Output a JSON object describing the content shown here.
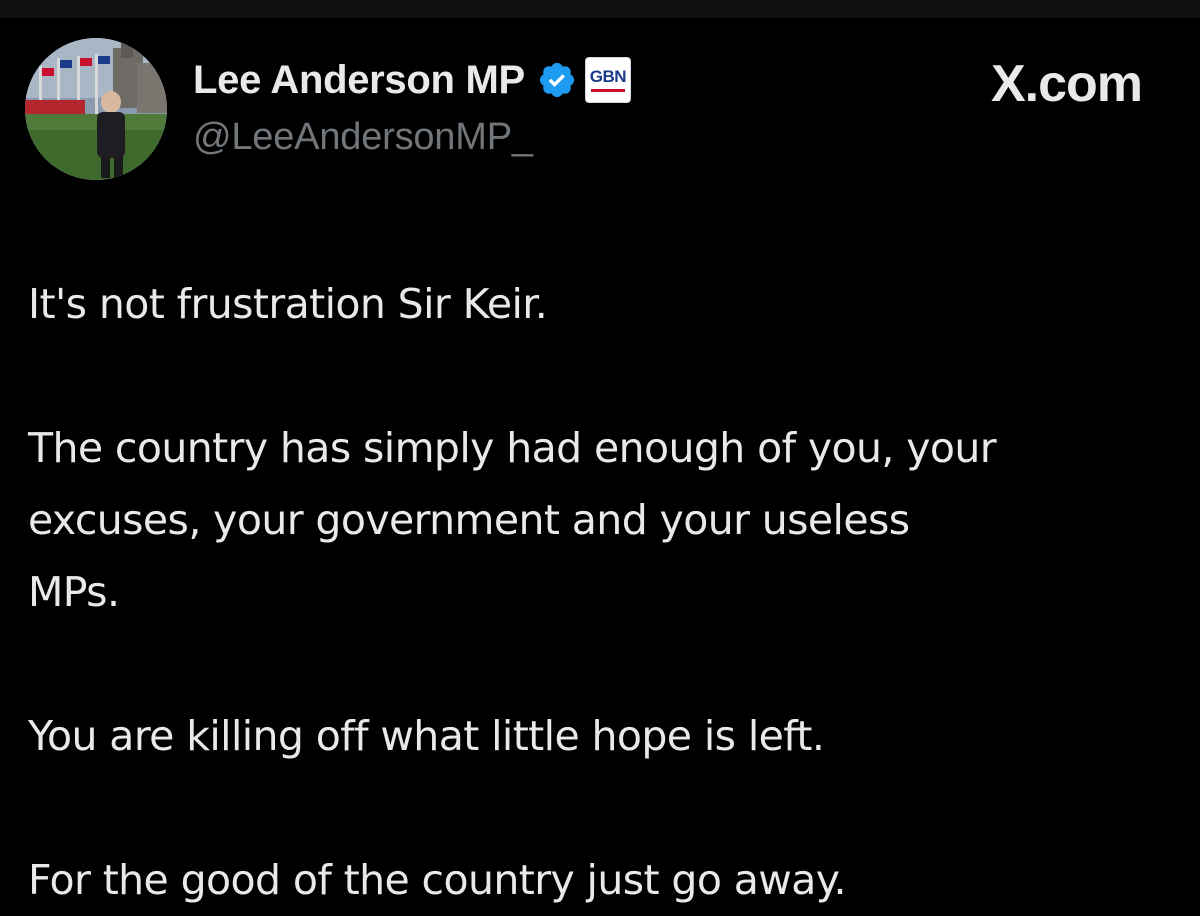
{
  "window": {
    "site_label": "X.com"
  },
  "tweet": {
    "author": {
      "display_name": "Lee Anderson MP",
      "handle": "@LeeAndersonMP_",
      "verified_icon": "verified-check-icon",
      "affiliate_badge_text": "GBN",
      "affiliate_badge_icon": "gb-news-logo",
      "avatar_icon": "profile-photo"
    },
    "paragraphs": {
      "p1": "It's not frustration Sir Keir.",
      "p2_line1": "The country has simply had enough of you, your",
      "p2_line2": "excuses, your government and your useless",
      "p2_line3": "MPs.",
      "p3": "You are killing off what little hope is left.",
      "p4": "For the good of the country just go away."
    }
  },
  "colors": {
    "background": "#000000",
    "text_primary": "#e7e9ea",
    "text_secondary": "#71767b",
    "verified_blue": "#1d9bf0"
  }
}
